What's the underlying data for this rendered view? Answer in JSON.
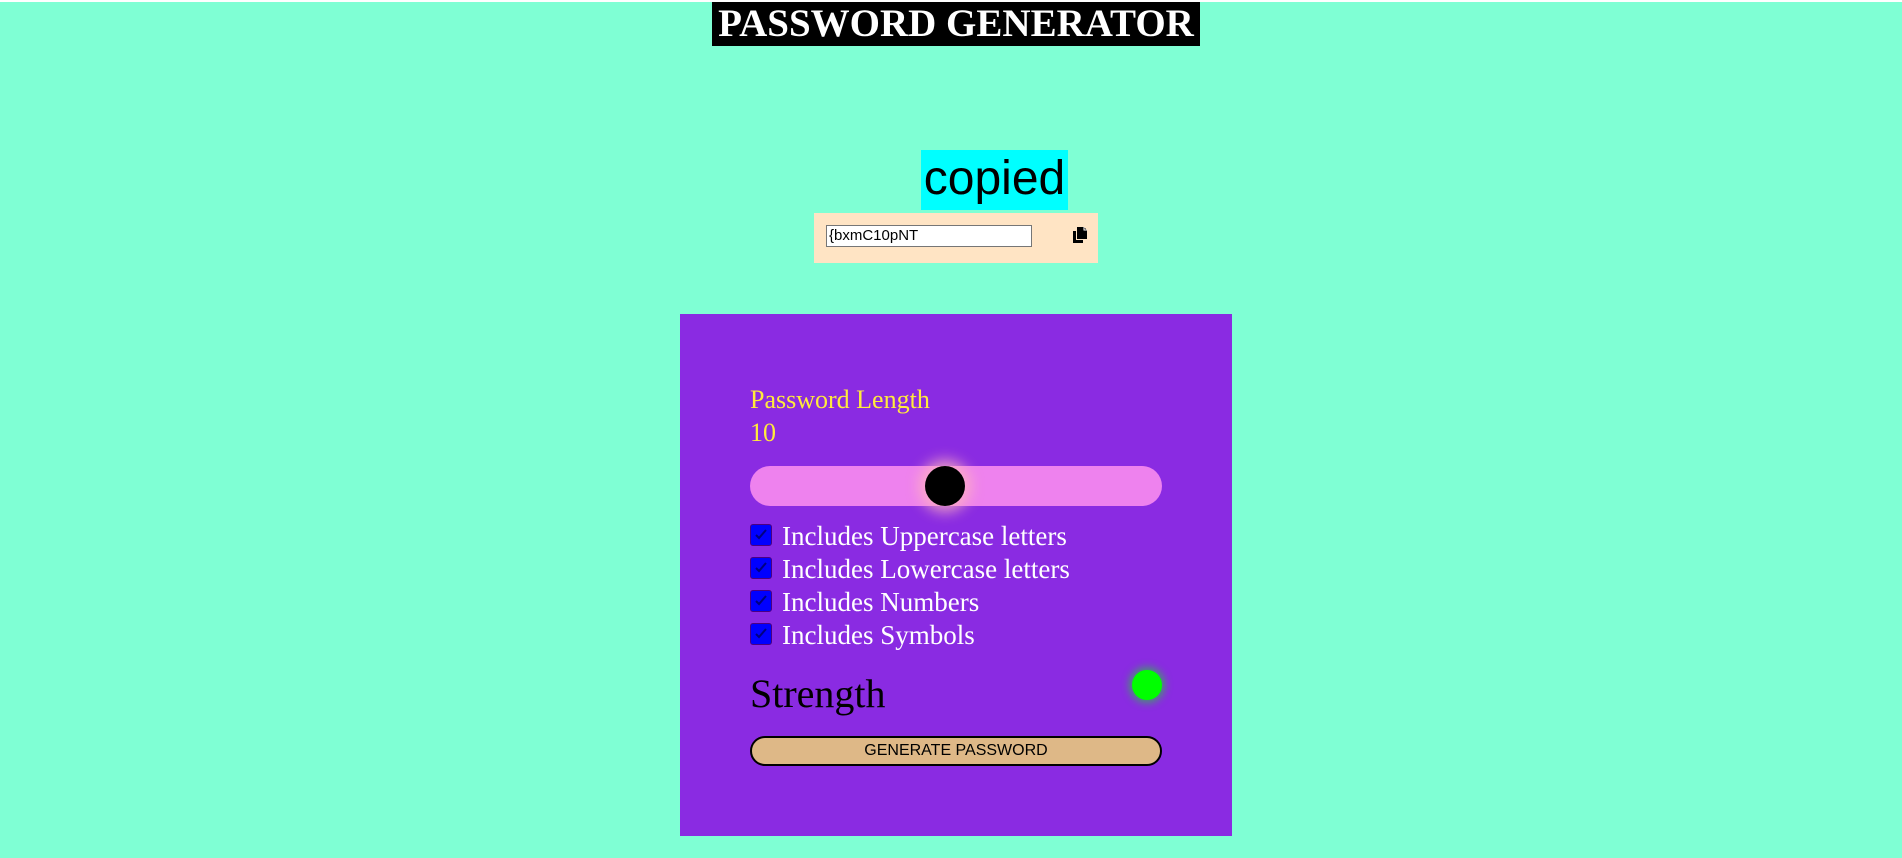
{
  "header": {
    "title": "PASSWORD GENERATOR"
  },
  "copy_status": {
    "text": "copied",
    "bg_color": "#00ffff"
  },
  "display": {
    "password_value": "{bxmC10pNT",
    "copy_icon": "copy-icon"
  },
  "controls": {
    "length_label": "Password Length",
    "length_value": "10",
    "slider": {
      "value": 10,
      "fraction": 0.47
    },
    "options": [
      {
        "label": "Includes Uppercase letters",
        "checked": true
      },
      {
        "label": "Includes Lowercase letters",
        "checked": true
      },
      {
        "label": "Includes Numbers",
        "checked": true
      },
      {
        "label": "Includes Symbols",
        "checked": true
      }
    ],
    "strength_label": "Strength",
    "strength_color": "#00ff00",
    "generate_label": "GENERATE PASSWORD"
  },
  "colors": {
    "page_bg": "#7fffd4",
    "panel_bg": "#8a2be2",
    "label_yellow": "#ffeb3b",
    "track": "#ee82ee",
    "button_bg": "#deb887",
    "display_bg": "#ffe4c4"
  }
}
